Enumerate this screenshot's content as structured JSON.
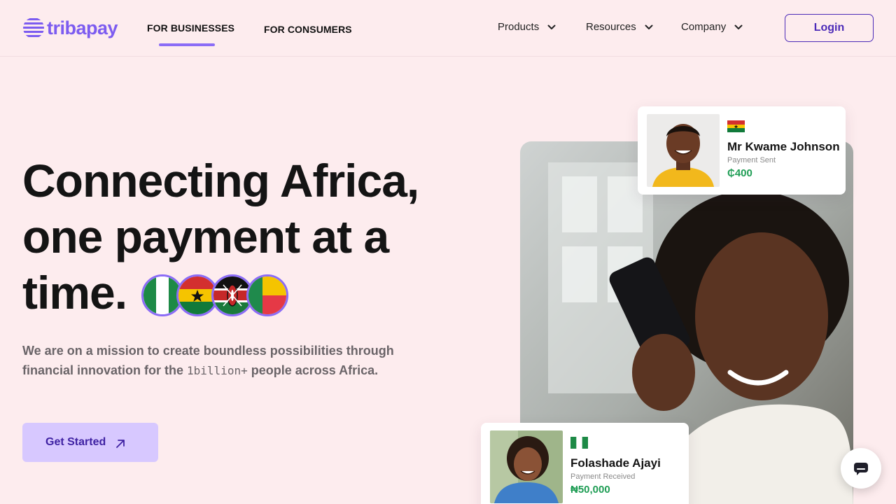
{
  "brand": {
    "name": "tribapay",
    "accent": "#7c5cf0",
    "cta_bg": "#d7c8ff",
    "cta_text": "#3f22a3",
    "page_bg": "#fdecee"
  },
  "header": {
    "segments": [
      {
        "label": "FOR BUSINESSES",
        "active": true
      },
      {
        "label": "FOR CONSUMERS",
        "active": false
      }
    ],
    "nav": [
      {
        "label": "Products",
        "icon": "chevron-down-icon"
      },
      {
        "label": "Resources",
        "icon": "chevron-down-icon"
      },
      {
        "label": "Company",
        "icon": "chevron-down-icon"
      }
    ],
    "login_label": "Login"
  },
  "hero": {
    "title_line1": "Connecting Africa,",
    "title_line2": "one payment at a",
    "title_line3": "time.",
    "flags": [
      "nigeria-flag-icon",
      "ghana-flag-icon",
      "kenya-flag-icon",
      "benin-flag-icon"
    ],
    "subtitle_part1": "We are on a mission to create boundless possibilities through financial innovation for the ",
    "subtitle_highlight": "1billion+",
    "subtitle_part2": " people across Africa.",
    "cta_label": "Get Started",
    "cta_icon": "arrow-up-right-icon"
  },
  "cards": [
    {
      "flag": "ghana-flag-icon",
      "name": "Mr Kwame Johnson",
      "status": "Payment Sent",
      "amount": "₵400",
      "amount_color": "#1f9d55"
    },
    {
      "flag": "nigeria-flag-icon",
      "name": "Folashade Ajayi",
      "status": "Payment Received",
      "amount": "₦50,000",
      "amount_color": "#1f9d55"
    }
  ],
  "chat": {
    "icon": "chat-icon"
  }
}
